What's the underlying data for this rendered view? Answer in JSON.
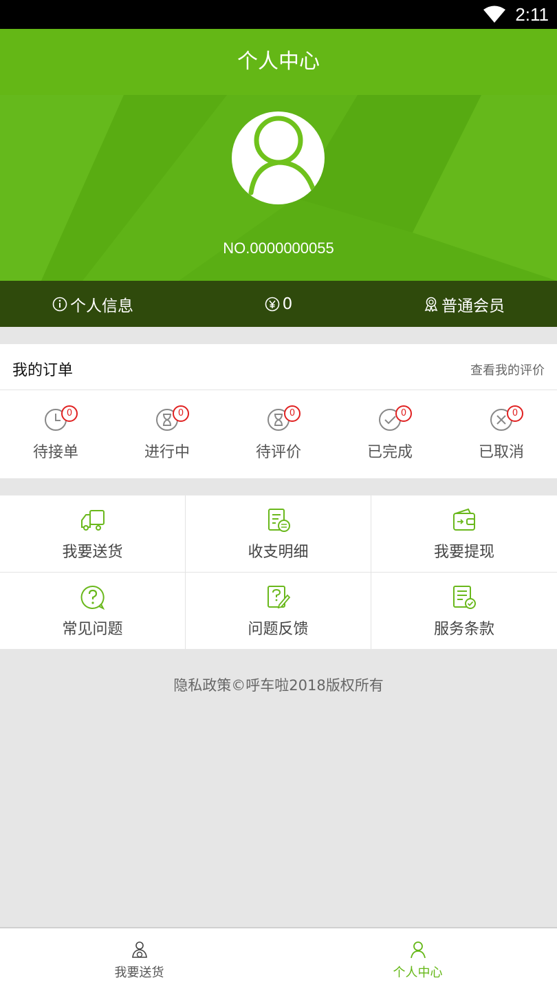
{
  "status_bar": {
    "time": "2:11",
    "wifi_icon": "wifi-icon"
  },
  "app_bar": {
    "title": "个人中心"
  },
  "profile": {
    "member_no": "NO.0000000055",
    "avatar_icon": "user-avatar-icon"
  },
  "info_bar": {
    "personal_info": "个人信息",
    "balance": "0",
    "member_level": "普通会员"
  },
  "orders": {
    "title": "我的订单",
    "view_reviews": "查看我的评价",
    "statuses": [
      {
        "label": "待接单",
        "count": "0",
        "icon": "clock-icon"
      },
      {
        "label": "进行中",
        "count": "0",
        "icon": "hourglass-icon"
      },
      {
        "label": "待评价",
        "count": "0",
        "icon": "hourglass-icon"
      },
      {
        "label": "已完成",
        "count": "0",
        "icon": "check-circle-icon"
      },
      {
        "label": "已取消",
        "count": "0",
        "icon": "x-circle-icon"
      }
    ]
  },
  "services": [
    {
      "label": "我要送货",
      "icon": "truck-icon"
    },
    {
      "label": "收支明细",
      "icon": "bill-icon"
    },
    {
      "label": "我要提现",
      "icon": "wallet-icon"
    },
    {
      "label": "常见问题",
      "icon": "question-bubble-icon"
    },
    {
      "label": "问题反馈",
      "icon": "feedback-edit-icon"
    },
    {
      "label": "服务条款",
      "icon": "terms-document-icon"
    }
  ],
  "footer": {
    "text": "隐私政策©呼车啦2018版权所有"
  },
  "tab_bar": {
    "tabs": [
      {
        "label": "我要送货",
        "active": false
      },
      {
        "label": "个人中心",
        "active": true
      }
    ]
  },
  "colors": {
    "brand_green": "#64b716",
    "info_bar": "#2f4a0c",
    "badge_red": "#e02020"
  }
}
